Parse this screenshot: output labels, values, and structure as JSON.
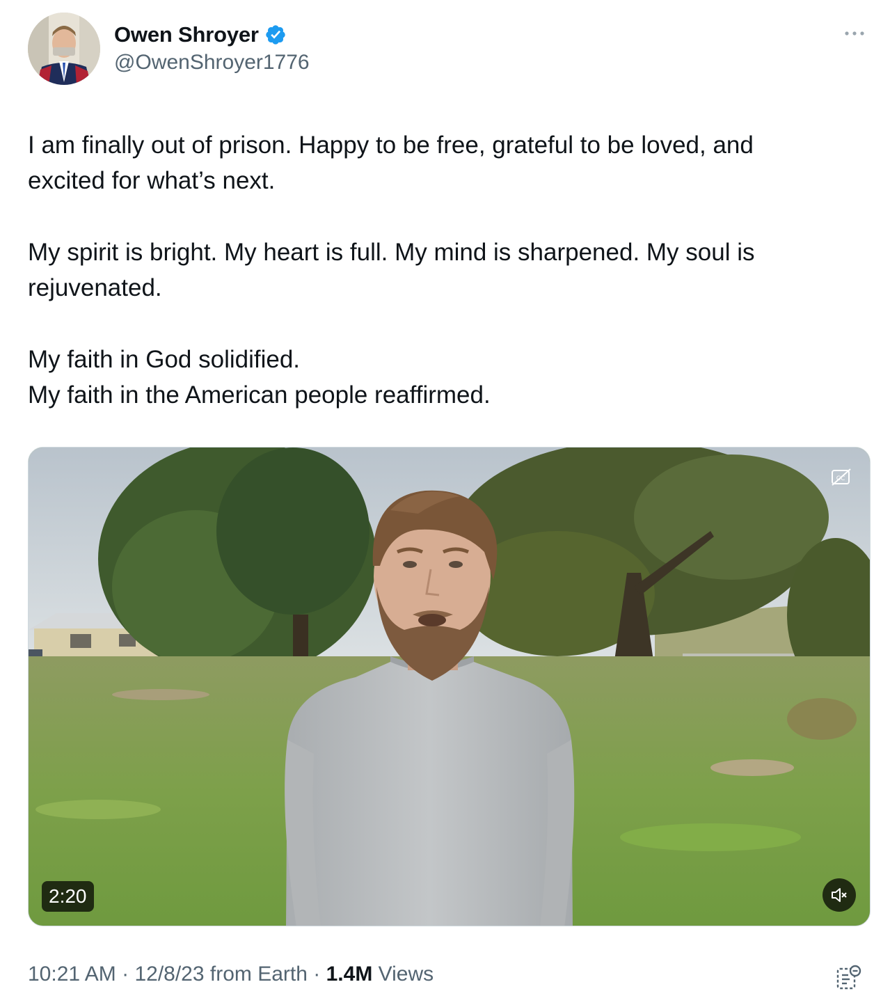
{
  "author": {
    "display_name": "Owen Shroyer",
    "handle": "@OwenShroyer1776",
    "verified": true
  },
  "tweet": {
    "paragraphs": [
      [
        "I am finally out of prison. Happy to be free, grateful to be loved, and",
        "excited for what’s next."
      ],
      [
        "My spirit is bright. My heart is full. My mind is sharpened. My soul is",
        "rejuvenated."
      ],
      [
        "My faith in God solidified.",
        "My faith in the American people reaffirmed."
      ]
    ]
  },
  "media": {
    "duration": "2:20",
    "muted": true
  },
  "meta": {
    "time": "10:21 AM",
    "date": "12/8/23",
    "source": "from Earth",
    "separator": "·",
    "views_count": "1.4M",
    "views_label": "Views"
  },
  "icons": {
    "verified": "verified-badge-icon",
    "more": "more-horizontal-icon",
    "captions": "closed-captions-icon",
    "mute": "speaker-muted-icon",
    "analytics": "post-analytics-icon"
  },
  "colors": {
    "text_primary": "#0f1419",
    "text_secondary": "#536471",
    "verified_blue": "#1d9bf0"
  }
}
